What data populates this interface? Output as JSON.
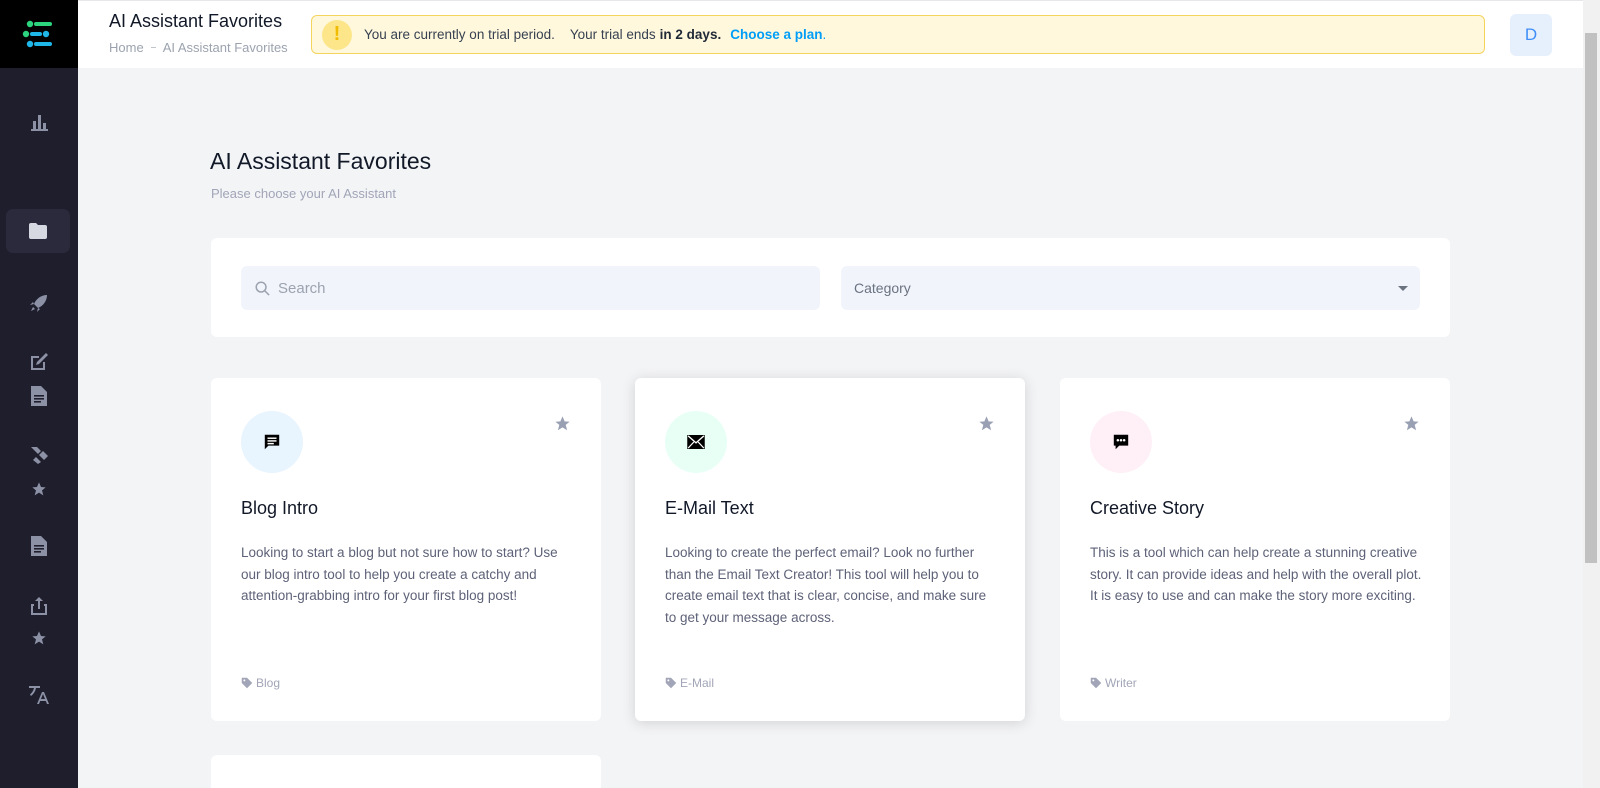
{
  "header": {
    "title": "AI Assistant Favorites",
    "breadcrumb": {
      "home": "Home",
      "current": "AI Assistant Favorites"
    }
  },
  "trial": {
    "icon_text": "!",
    "message": "You are currently on trial period.",
    "ends_prefix": "Your trial ends",
    "ends_bold": "in 2 days.",
    "plan_link": "Choose a plan",
    "plan_suffix": "."
  },
  "avatar": {
    "initial": "D"
  },
  "main": {
    "title": "AI Assistant Favorites",
    "subtitle": "Please choose your AI Assistant"
  },
  "filters": {
    "search_placeholder": "Search",
    "category_value": "Category"
  },
  "cards": [
    {
      "title": "Blog Intro",
      "description": "Looking to start a blog but not sure how to start? Use our blog intro tool to help you create a catchy and attention-grabbing intro for your first blog post!",
      "tag": "Blog",
      "icon": "message-square-icon",
      "icon_bg": "#e8f4fe"
    },
    {
      "title": "E-Mail Text",
      "description": "Looking to create the perfect email? Look no further than the Email Text Creator! This tool will help you to create email text that is clear, concise, and make sure to get your message across.",
      "tag": "E-Mail",
      "icon": "envelope-icon",
      "icon_bg": "#e8fff6"
    },
    {
      "title": "Creative Story",
      "description": "This is a tool which can help create a stunning creative story. It can provide ideas and help with the overall plot. It is easy to use and can make the story more exciting.",
      "tag": "Writer",
      "icon": "chat-dots-icon",
      "icon_bg": "#fff0f7"
    }
  ],
  "colors": {
    "sidebar": "#1e1e2d",
    "accent": "#009ef7",
    "trial_bg": "#fff8dd",
    "trial_border": "#f5d45e",
    "star": "#9aa0b4"
  }
}
